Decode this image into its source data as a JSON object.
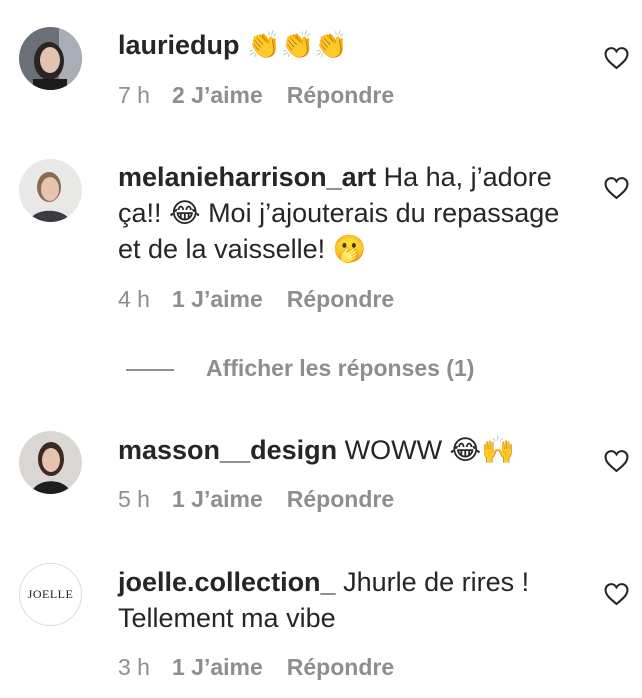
{
  "comments": [
    {
      "username": "lauriedup",
      "text": " 👏👏👏",
      "time": "7 h",
      "likes": "2 J’aime",
      "reply": "Répondre"
    },
    {
      "username": "melanieharrison_art",
      "text": " Ha ha, j’adore ça!! 😂 Moi j’ajouterais du repassage et de la vaisselle! 🫢",
      "time": "4 h",
      "likes": "1 J’aime",
      "reply": "Répondre"
    },
    {
      "username": "masson__design",
      "text": " WOWW 😂🙌",
      "time": "5 h",
      "likes": "1 J’aime",
      "reply": "Répondre"
    },
    {
      "username": "joelle.collection_",
      "text": " Jhurle de rires ! Tellement ma vibe",
      "time": "3 h",
      "likes": "1 J’aime",
      "reply": "Répondre",
      "avatar_text": "JOELLE"
    }
  ],
  "view_replies": "Afficher les réponses (1)",
  "icons": {
    "like": "heart-outline-icon"
  },
  "colors": {
    "text": "#262626",
    "secondary": "#8e8e8e"
  }
}
